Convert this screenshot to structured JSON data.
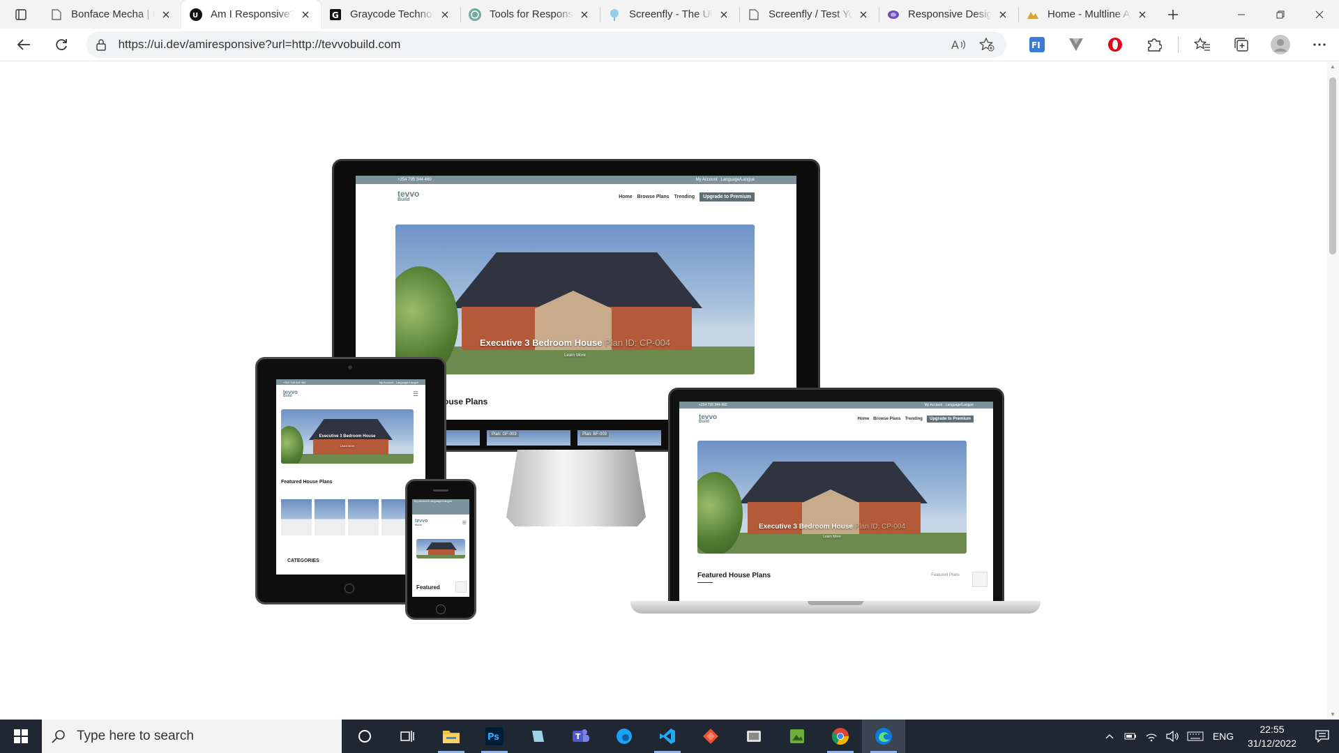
{
  "browser": {
    "tabs": [
      {
        "title": "Bonface Mecha | F",
        "icon": "page-icon",
        "active": false
      },
      {
        "title": "Am I Responsive?",
        "icon": "ui-dev-icon",
        "active": true
      },
      {
        "title": "Graycode Technol",
        "icon": "graycode-icon",
        "active": false
      },
      {
        "title": "Tools for Respons",
        "icon": "openai-icon",
        "active": false
      },
      {
        "title": "Screenfly - The Ul",
        "icon": "screenfly-icon",
        "active": false
      },
      {
        "title": "Screenfly / Test Yo",
        "icon": "page-icon",
        "active": false
      },
      {
        "title": "Responsive Desig",
        "icon": "responsive-icon",
        "active": false
      },
      {
        "title": "Home - Multline A",
        "icon": "multline-icon",
        "active": false
      }
    ],
    "url": "https://ui.dev/amiresponsive?url=http://tevvobuild.com"
  },
  "site": {
    "phone_number": "+254 795 344 460",
    "account_menu": "My Account",
    "language_menu": "Language/Langue",
    "logo_line1": "tevvo",
    "logo_line2": "Build",
    "nav_home": "Home",
    "nav_browse": "Browse Plans",
    "nav_trending": "Trending",
    "nav_premium": "Upgrade to Premium",
    "hero_title": "Executive 3 Bedroom House",
    "hero_plan": "Plan ID: CP-004",
    "hero_cta": "Learn More",
    "featured_heading": "Featured House Plans",
    "featured_heading_short": "ouse Plans",
    "featured_link": "Featured Plans",
    "categories_heading": "CATEGORIES",
    "phone_featured": "Featured",
    "plan_card_1": "Plan: GF-003",
    "plan_card_2": "Plan: BF-003"
  },
  "taskbar": {
    "search_placeholder": "Type here to search",
    "apps": [
      "cortana-icon",
      "task-view-icon",
      "file-explorer-icon",
      "photoshop-icon",
      "app-icon",
      "teams-icon",
      "edge-beta-icon",
      "vscode-icon",
      "git-icon",
      "app-icon",
      "app-icon",
      "chrome-icon",
      "edge-icon"
    ],
    "language": "ENG",
    "time": "22:55",
    "date": "31/12/2022"
  }
}
